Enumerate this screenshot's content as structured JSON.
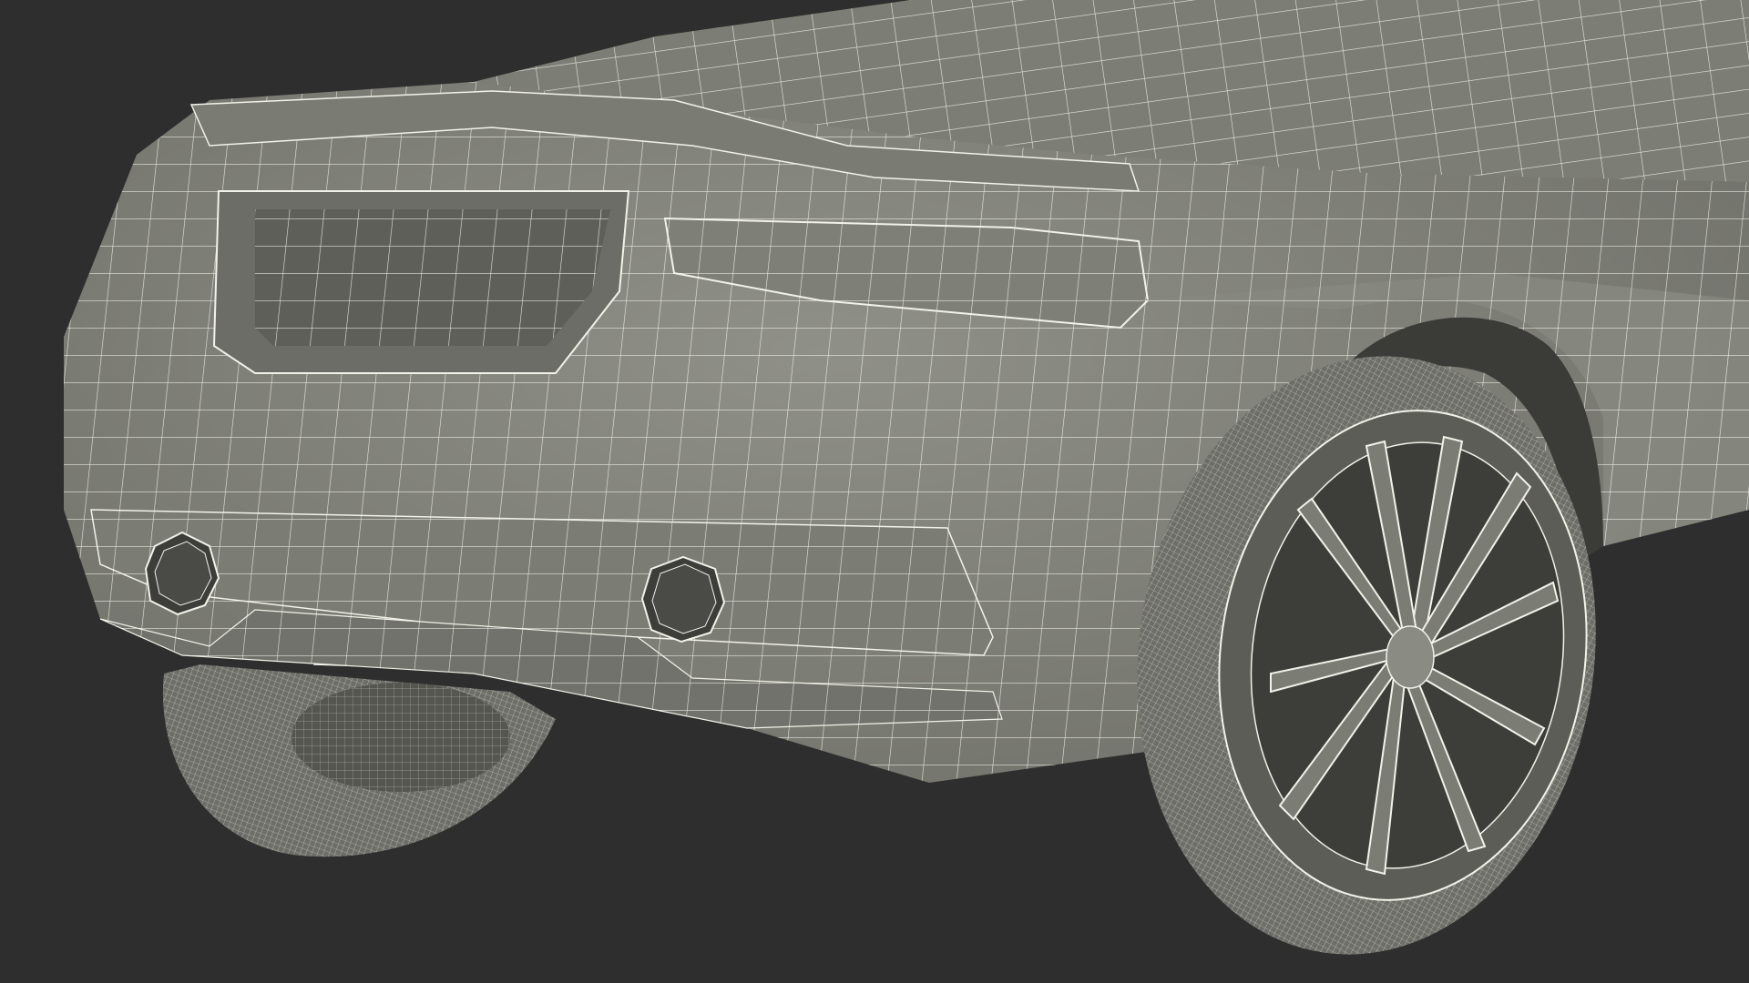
{
  "scene": {
    "subject": "wireframe-car-rear",
    "colors": {
      "background": "#2e2e2e",
      "body_fill": "#8a8b82",
      "body_shade": "#6f7069",
      "body_dark": "#4f504b",
      "wire": "#f2f2e8",
      "tire": "#6d6e68",
      "cavity": "#3d3e3a"
    }
  }
}
